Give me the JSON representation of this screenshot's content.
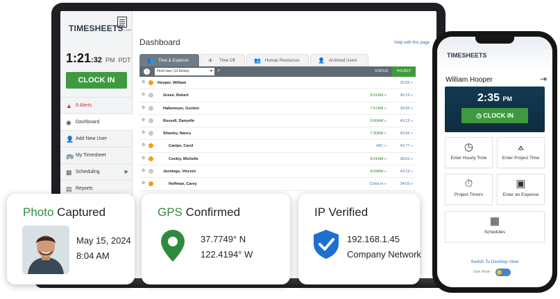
{
  "laptop": {
    "logo": "TIMESHEETS",
    "logo_suffix": ".com",
    "clock": {
      "time": "1:21",
      "seconds": ":32",
      "period": "PM",
      "tz": "PDT"
    },
    "clock_in_label": "CLOCK IN",
    "nav": [
      {
        "label": "9 Alerts",
        "icon": "warning-icon"
      },
      {
        "label": "Dashboard",
        "icon": "dashboard-icon"
      },
      {
        "label": "Add New User",
        "icon": "add-user-icon"
      },
      {
        "label": "My Timesheet",
        "icon": "timesheet-icon"
      },
      {
        "label": "Scheduling",
        "icon": "calendar-icon"
      },
      {
        "label": "Reports",
        "icon": "reports-icon"
      }
    ],
    "dashboard_title": "Dashboard",
    "help_link": "Help with this page",
    "tabs": [
      "Time & Expense",
      "Time Off",
      "Human Resources",
      "Archived Users"
    ],
    "find_user_placeholder": "Find User (12 Active)",
    "col_status": "STATUS",
    "col_hourly": "HOURLY",
    "rows": [
      {
        "name": "Hooper, William",
        "status": "",
        "hourly": "32.65 »",
        "indent": 0
      },
      {
        "name": "Green, Robert",
        "status": "8:01AM »",
        "hourly": "40.19 »",
        "indent": 1
      },
      {
        "name": "Hallemeyer, Gordon",
        "status": "7:57AM »",
        "hourly": "39.92 »",
        "indent": 1
      },
      {
        "name": "Russell, Danyelle",
        "status": "9:00AM »",
        "hourly": "40.12 »",
        "indent": 1
      },
      {
        "name": "Shanley, Nancy",
        "status": "7:30AM »",
        "hourly": "40.56 »",
        "indent": 1
      },
      {
        "name": "Canipe, Carol",
        "status": "VAC »",
        "hourly": "43.77 »",
        "indent": 2
      },
      {
        "name": "Conley, Michelle",
        "status": "8:01AM »",
        "hourly": "38.02 »",
        "indent": 2
      },
      {
        "name": "Jennings, Vincent",
        "status": "8:04AM »",
        "hourly": "43.19 »",
        "indent": 1
      },
      {
        "name": "Huffman, Carey",
        "status": "Clock In »",
        "hourly": "34.03 »",
        "indent": 2
      }
    ]
  },
  "phone": {
    "logo": "TIMESHEETS",
    "user_name": "William Hooper",
    "time": "2:35",
    "period": "PM",
    "clock_in_label": "CLOCK IN",
    "tiles": [
      {
        "label": "Enter Hourly Time",
        "icon": "clock-icon"
      },
      {
        "label": "Enter Project Time",
        "icon": "compass-icon"
      },
      {
        "label": "Project Timers",
        "icon": "stopwatch-icon"
      },
      {
        "label": "Enter an Expense",
        "icon": "money-icon"
      },
      {
        "label": "Schedules",
        "icon": "calendar-icon"
      }
    ],
    "switch_view": "Switch To Desktop View",
    "dark_mode": "Dark Mode"
  },
  "cards": {
    "photo": {
      "title_accent": "Photo",
      "title_rest": " Captured",
      "date": "May 15, 2024",
      "time": "8:04 AM"
    },
    "gps": {
      "title_accent": "GPS",
      "title_rest": " Confirmed",
      "lat": "37.7749° N",
      "lon": "122.4194° W"
    },
    "ip": {
      "title": "IP Verified",
      "address": "192.168.1.45",
      "network": "Company Network"
    }
  },
  "colors": {
    "accent_green": "#3f9a3f",
    "brand_green_text": "#2e8b3e",
    "link_blue": "#3b6db4",
    "dark_panel": "#123a52"
  }
}
